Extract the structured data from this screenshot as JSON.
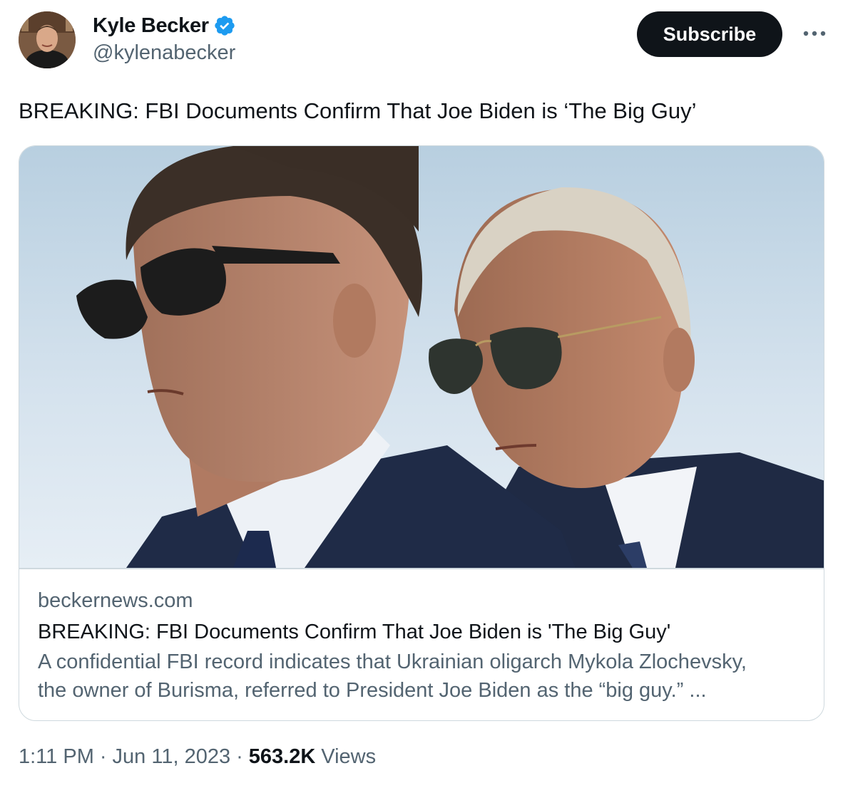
{
  "author": {
    "display_name": "Kyle Becker",
    "handle": "@kylenabecker",
    "verified_icon": "verified-badge-icon",
    "badge_color": "#1d9bf0"
  },
  "header": {
    "subscribe_label": "Subscribe",
    "more_icon": "more-horizontal-icon"
  },
  "tweet": {
    "text": "BREAKING: FBI Documents Confirm That Joe Biden is ‘The Big Guy’"
  },
  "card": {
    "domain": "beckernews.com",
    "title": "BREAKING: FBI Documents Confirm That Joe Biden is 'The Big Guy'",
    "description_line1": "A confidential FBI record indicates that Ukrainian oligarch Mykola Zlochevsky,",
    "description_line2": "the owner of Burisma, referred to President Joe Biden as the “big guy.” ..."
  },
  "meta": {
    "time": "1:11 PM",
    "date": "Jun 11, 2023",
    "separator": "·",
    "views_count": "563.2K",
    "views_label": "Views"
  },
  "colors": {
    "text_primary": "#0f1419",
    "text_secondary": "#536471",
    "border": "#cfd9de",
    "button_bg": "#0f1419"
  }
}
